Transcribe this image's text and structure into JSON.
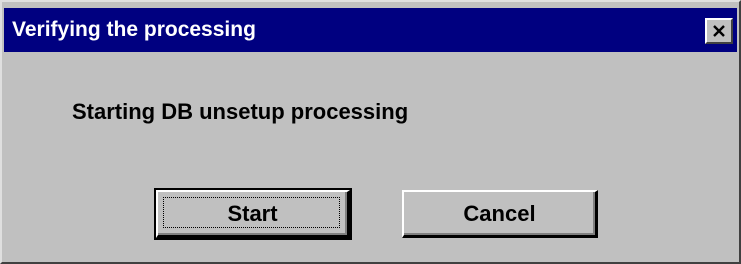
{
  "window": {
    "title": "Verifying the processing",
    "close_icon": "close-icon"
  },
  "dialog": {
    "message": "Starting DB unsetup processing"
  },
  "buttons": {
    "start_label": "Start",
    "cancel_label": "Cancel",
    "focused": "Start"
  },
  "colors": {
    "titlebar": "#000080",
    "title_text": "#ffffff",
    "window_face": "#c0c0c0"
  }
}
